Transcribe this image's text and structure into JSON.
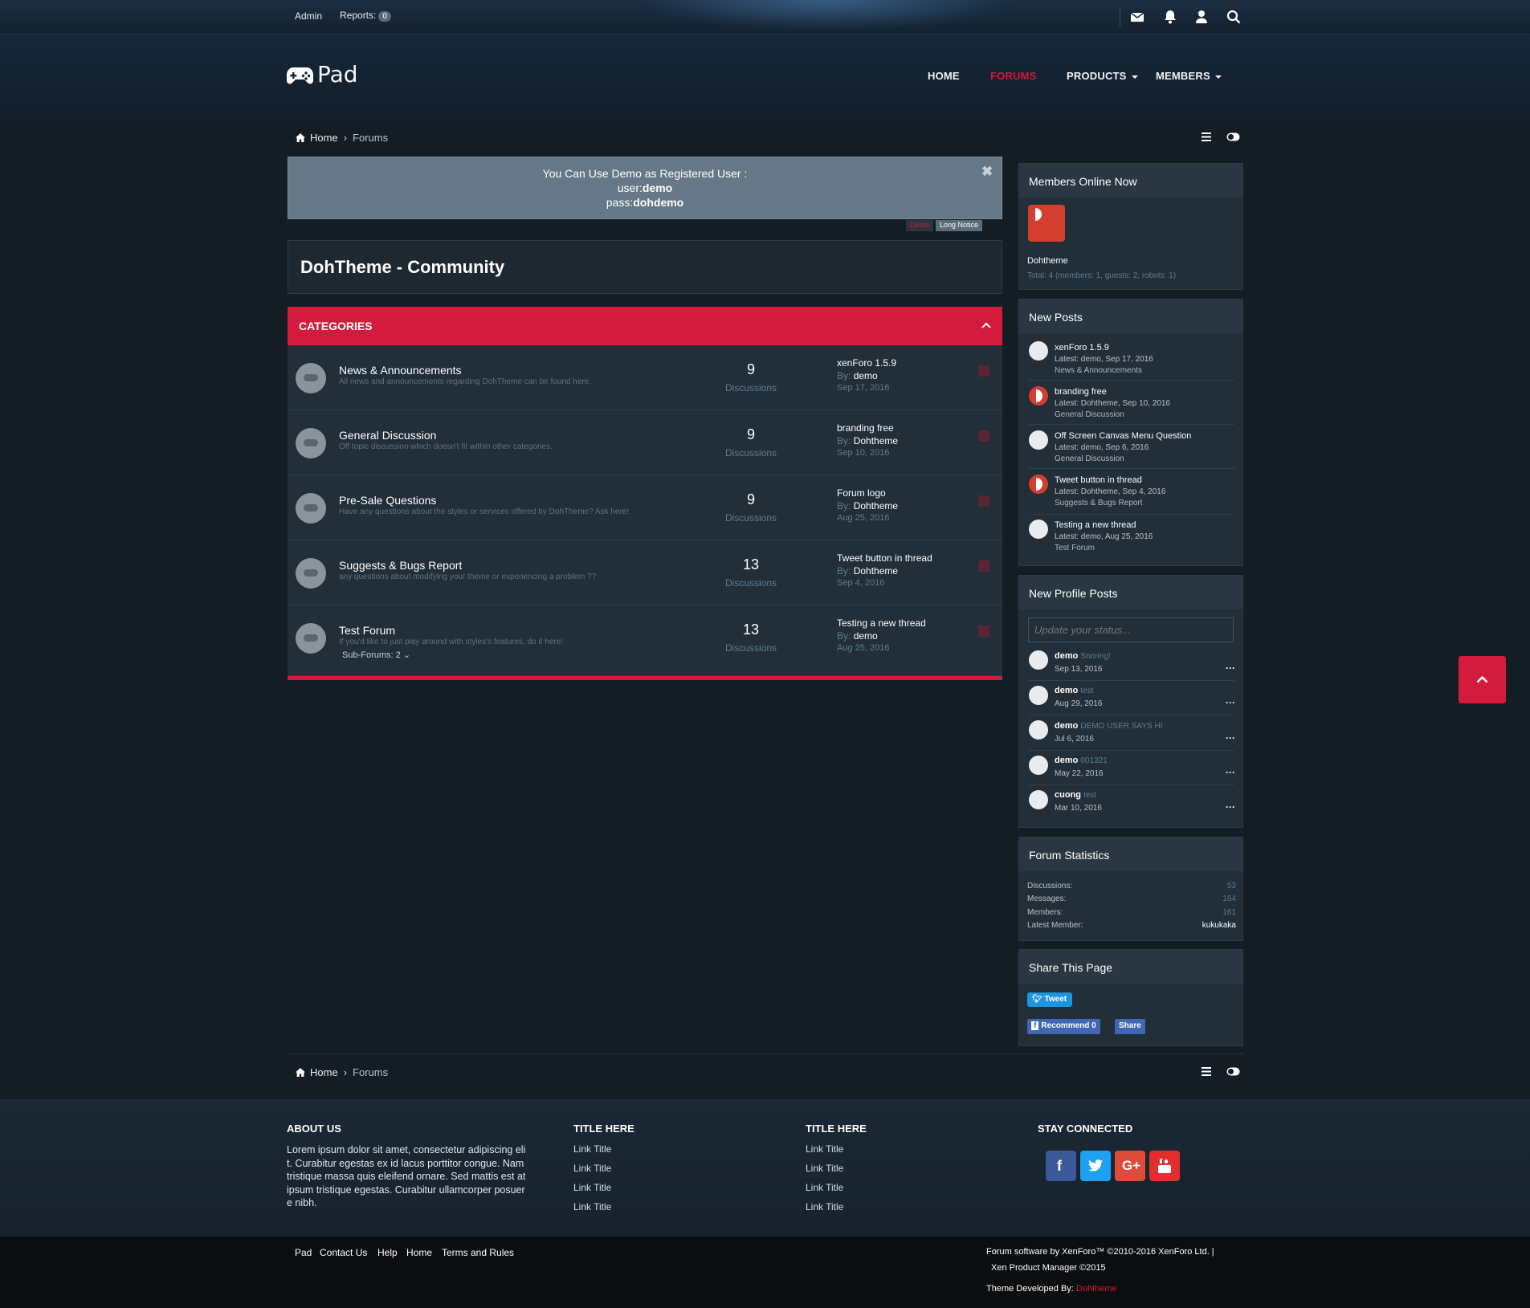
{
  "topbar": {
    "admin": "Admin",
    "reports": "Reports:",
    "reports_count": "0"
  },
  "header": {
    "logo": "Pad",
    "nav": {
      "home": "HOME",
      "forums": "FORUMS",
      "products": "PRODUCTS",
      "members": "MEMBERS"
    }
  },
  "breadcrumb": {
    "home": "Home",
    "current": "Forums"
  },
  "notice": {
    "line1": "You Can Use Demo as Registered User :",
    "user_label": "user:",
    "user": "demo",
    "pass_label": "pass:",
    "pass": "dohdemo",
    "tab_demo": "Demo",
    "tab_long": "Long Notice"
  },
  "page_title": "DohTheme - Community",
  "categories": {
    "title": "CATEGORIES",
    "forums": [
      {
        "title": "News & Announcements",
        "desc": "All news and announcements regarding DohTheme can be found here.",
        "count": "9",
        "count_label": "Discussions",
        "last_title": "xenForo 1.5.9",
        "by": "By:",
        "last_user": "demo",
        "last_date": "Sep 17, 2016"
      },
      {
        "title": "General Discussion",
        "desc": "Off topic discussion which doesn't fit within other categories.",
        "count": "9",
        "count_label": "Discussions",
        "last_title": "branding free",
        "by": "By:",
        "last_user": "Dohtheme",
        "last_date": "Sep 10, 2016"
      },
      {
        "title": "Pre-Sale Questions",
        "desc": "Have any questions about the styles or services offered by DohTheme? Ask here!",
        "count": "9",
        "count_label": "Discussions",
        "last_title": "Forum logo",
        "by": "By:",
        "last_user": "Dohtheme",
        "last_date": "Aug 25, 2016"
      },
      {
        "title": "Suggests & Bugs Report",
        "desc": "any questions about modifying your theme or experiencing a problem ??",
        "count": "13",
        "count_label": "Discussions",
        "last_title": "Tweet button in thread",
        "by": "By:",
        "last_user": "Dohtheme",
        "last_date": "Sep 4, 2016"
      },
      {
        "title": "Test Forum",
        "desc": "If you'd like to just play around with styles's features, do it here!",
        "sub": "Sub-Forums: 2",
        "count": "13",
        "count_label": "Discussions",
        "last_title": "Testing a new thread",
        "by": "By:",
        "last_user": "demo",
        "last_date": "Aug 25, 2016"
      }
    ]
  },
  "sidebar": {
    "online": {
      "title": "Members Online Now",
      "member": "Dohtheme",
      "total": "Total: 4 (members: 1, guests: 2, robots: 1)"
    },
    "new_posts": {
      "title": "New Posts",
      "items": [
        {
          "title": "xenForo 1.5.9",
          "latest": "Latest: demo, Sep 17, 2016",
          "forum": "News & Announcements"
        },
        {
          "title": "branding free",
          "latest": "Latest: Dohtheme, Sep 10, 2016",
          "forum": "General Discussion"
        },
        {
          "title": "Off Screen Canvas Menu Question",
          "latest": "Latest: demo, Sep 6, 2016",
          "forum": "General Discussion"
        },
        {
          "title": "Tweet button in thread",
          "latest": "Latest: Dohtheme, Sep 4, 2016",
          "forum": "Suggests & Bugs Report"
        },
        {
          "title": "Testing a new thread",
          "latest": "Latest: demo, Aug 25, 2016",
          "forum": "Test Forum"
        }
      ]
    },
    "profile_posts": {
      "title": "New Profile Posts",
      "placeholder": "Update your status...",
      "items": [
        {
          "user": "demo",
          "status": "Snoring!",
          "date": "Sep 13, 2016"
        },
        {
          "user": "demo",
          "status": "test",
          "date": "Aug 29, 2016"
        },
        {
          "user": "demo",
          "status": "DEMO USER SAYS HI",
          "date": "Jul 6, 2016"
        },
        {
          "user": "demo",
          "status": "001321",
          "date": "May 22, 2016"
        },
        {
          "user": "cuong",
          "status": "test",
          "date": "Mar 10, 2016"
        }
      ]
    },
    "stats": {
      "title": "Forum Statistics",
      "discussions_label": "Discussions:",
      "discussions": "53",
      "messages_label": "Messages:",
      "messages": "164",
      "members_label": "Members:",
      "members": "161",
      "latest_label": "Latest Member:",
      "latest": "kukukaka"
    },
    "share": {
      "title": "Share This Page",
      "tweet": "Tweet",
      "recommend": "Recommend 0",
      "share": "Share"
    }
  },
  "footer": {
    "about_title": "ABOUT US",
    "about_text": "Lorem ipsum dolor sit amet, consectetur adipiscing elit. Curabitur egestas ex id lacus porttitor congue. Nam tristique massa quis eleifend ornare. Sed mattis est at ipsum tristique egestas. Curabitur ullamcorper posuere nibh.",
    "col2_title": "TITLE HERE",
    "col3_title": "TITLE HERE",
    "link": "Link Title",
    "stay": "STAY CONNECTED"
  },
  "copyright": {
    "links": [
      "Pad",
      "Contact Us",
      "Help",
      "Home",
      "Terms and Rules"
    ],
    "line1": "Forum software by XenForo™ ©2010-2016 XenForo Ltd. |",
    "line2": "Xen Product Manager ©2015",
    "dev_label": "Theme Developed By:",
    "dev": "Dohtheme"
  },
  "colors": {
    "accent": "#d31b3d",
    "bg": "#141c24",
    "panel": "#222e38"
  }
}
